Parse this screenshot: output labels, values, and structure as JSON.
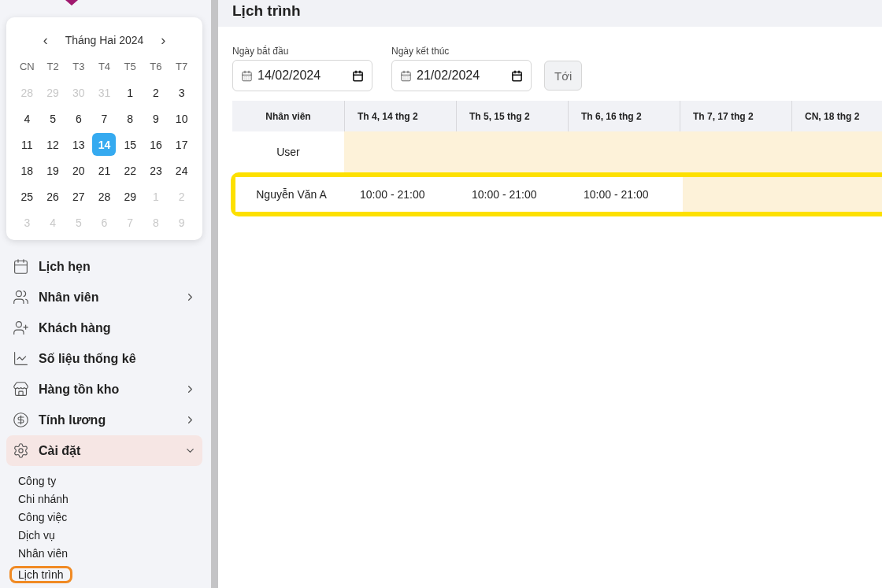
{
  "calendar": {
    "month": "Tháng Hai 2024",
    "prev": "‹",
    "next": "›",
    "weekdays": [
      "CN",
      "T2",
      "T3",
      "T4",
      "T5",
      "T6",
      "T7"
    ],
    "weeks": [
      [
        {
          "day": "28",
          "outside": true,
          "selected": false
        },
        {
          "day": "29",
          "outside": true,
          "selected": false
        },
        {
          "day": "30",
          "outside": true,
          "selected": false
        },
        {
          "day": "31",
          "outside": true,
          "selected": false
        },
        {
          "day": "1",
          "outside": false,
          "selected": false
        },
        {
          "day": "2",
          "outside": false,
          "selected": false
        },
        {
          "day": "3",
          "outside": false,
          "selected": false
        }
      ],
      [
        {
          "day": "4",
          "outside": false,
          "selected": false
        },
        {
          "day": "5",
          "outside": false,
          "selected": false
        },
        {
          "day": "6",
          "outside": false,
          "selected": false
        },
        {
          "day": "7",
          "outside": false,
          "selected": false
        },
        {
          "day": "8",
          "outside": false,
          "selected": false
        },
        {
          "day": "9",
          "outside": false,
          "selected": false
        },
        {
          "day": "10",
          "outside": false,
          "selected": false
        }
      ],
      [
        {
          "day": "11",
          "outside": false,
          "selected": false
        },
        {
          "day": "12",
          "outside": false,
          "selected": false
        },
        {
          "day": "13",
          "outside": false,
          "selected": false
        },
        {
          "day": "14",
          "outside": false,
          "selected": true
        },
        {
          "day": "15",
          "outside": false,
          "selected": false
        },
        {
          "day": "16",
          "outside": false,
          "selected": false
        },
        {
          "day": "17",
          "outside": false,
          "selected": false
        }
      ],
      [
        {
          "day": "18",
          "outside": false,
          "selected": false
        },
        {
          "day": "19",
          "outside": false,
          "selected": false
        },
        {
          "day": "20",
          "outside": false,
          "selected": false
        },
        {
          "day": "21",
          "outside": false,
          "selected": false
        },
        {
          "day": "22",
          "outside": false,
          "selected": false
        },
        {
          "day": "23",
          "outside": false,
          "selected": false
        },
        {
          "day": "24",
          "outside": false,
          "selected": false
        }
      ],
      [
        {
          "day": "25",
          "outside": false,
          "selected": false
        },
        {
          "day": "26",
          "outside": false,
          "selected": false
        },
        {
          "day": "27",
          "outside": false,
          "selected": false
        },
        {
          "day": "28",
          "outside": false,
          "selected": false
        },
        {
          "day": "29",
          "outside": false,
          "selected": false
        },
        {
          "day": "1",
          "outside": true,
          "selected": false
        },
        {
          "day": "2",
          "outside": true,
          "selected": false
        }
      ],
      [
        {
          "day": "3",
          "outside": true,
          "selected": false
        },
        {
          "day": "4",
          "outside": true,
          "selected": false
        },
        {
          "day": "5",
          "outside": true,
          "selected": false
        },
        {
          "day": "6",
          "outside": true,
          "selected": false
        },
        {
          "day": "7",
          "outside": true,
          "selected": false
        },
        {
          "day": "8",
          "outside": true,
          "selected": false
        },
        {
          "day": "9",
          "outside": true,
          "selected": false
        }
      ]
    ]
  },
  "sidebar": {
    "items": [
      {
        "label": "Lịch hẹn",
        "kind": "link",
        "selected": false
      },
      {
        "label": "Nhân viên",
        "kind": "group",
        "expanded": false,
        "selected": false
      },
      {
        "label": "Khách hàng",
        "kind": "link",
        "selected": false
      },
      {
        "label": "Số liệu thống kê",
        "kind": "link",
        "selected": false
      },
      {
        "label": "Hàng tồn kho",
        "kind": "group",
        "expanded": false,
        "selected": false
      },
      {
        "label": "Tính lương",
        "kind": "group",
        "expanded": false,
        "selected": false
      },
      {
        "label": "Cài đặt",
        "kind": "group",
        "expanded": true,
        "selected": true,
        "children": [
          {
            "label": "Công ty",
            "highlighted": false
          },
          {
            "label": "Chi nhánh",
            "highlighted": false
          },
          {
            "label": "Công việc",
            "highlighted": false
          },
          {
            "label": "Dịch vụ",
            "highlighted": false
          },
          {
            "label": "Nhân viên",
            "highlighted": false
          },
          {
            "label": "Lịch trình",
            "highlighted": true
          }
        ]
      }
    ]
  },
  "page": {
    "title": "Lịch trình"
  },
  "filters": {
    "start": {
      "label": "Ngày bắt đầu",
      "value": "14/02/2024"
    },
    "end": {
      "label": "Ngày kết thúc",
      "value": "21/02/2024"
    },
    "button": "Tới"
  },
  "table": {
    "columns": [
      "Nhân viên",
      "Th 4, 14 thg 2",
      "Th 5, 15 thg 2",
      "Th 6, 16 thg 2",
      "Th 7, 17 thg 2",
      "CN, 18 thg 2"
    ],
    "rows": [
      {
        "highlighted": false,
        "cells": [
          {
            "kind": "name",
            "text": "User"
          },
          {
            "kind": "day",
            "scheduled": false
          },
          {
            "kind": "day",
            "scheduled": false
          },
          {
            "kind": "day",
            "scheduled": false
          },
          {
            "kind": "day",
            "scheduled": false
          },
          {
            "kind": "day",
            "scheduled": false
          }
        ]
      },
      {
        "highlighted": true,
        "cells": [
          {
            "kind": "name",
            "text": "Nguyễn Văn A"
          },
          {
            "kind": "day",
            "scheduled": true,
            "text": "10:00 - 21:00"
          },
          {
            "kind": "day",
            "scheduled": true,
            "text": "10:00 - 21:00"
          },
          {
            "kind": "day",
            "scheduled": true,
            "text": "10:00 - 21:00"
          },
          {
            "kind": "day",
            "scheduled": false
          },
          {
            "kind": "day",
            "scheduled": false
          }
        ]
      }
    ]
  }
}
